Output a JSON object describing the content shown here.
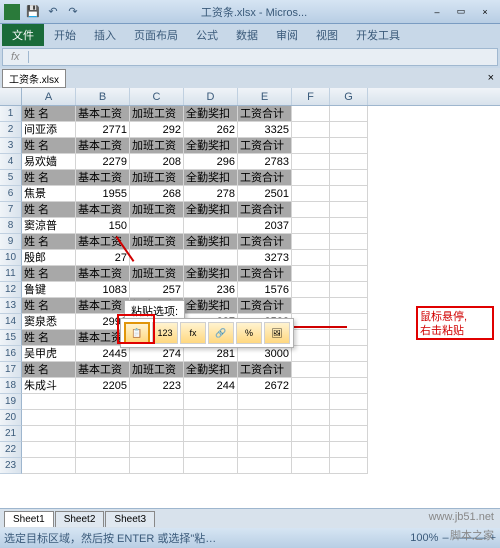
{
  "titlebar": {
    "filename": "工资条.xlsx - Micros...",
    "minimize": "–",
    "restore": "▭",
    "close": "×"
  },
  "qat": {
    "save": "💾",
    "undo": "↶",
    "redo": "↷"
  },
  "ribbon": {
    "file": "文件",
    "tabs": [
      "开始",
      "插入",
      "页面布局",
      "公式",
      "数据",
      "审阅",
      "视图",
      "开发工具"
    ]
  },
  "fx": {
    "label": "fx"
  },
  "workbook": {
    "name": "工资条.xlsx",
    "close": "×"
  },
  "columns": [
    "A",
    "B",
    "C",
    "D",
    "E",
    "F",
    "G"
  ],
  "headers": [
    "姓 名",
    "基本工资",
    "加班工资",
    "全勤奖扣",
    "工资合计"
  ],
  "grid_rows": [
    {
      "n": 1,
      "kind": "h"
    },
    {
      "n": 2,
      "kind": "d",
      "a": "间亚添",
      "b": "2771",
      "c": "292",
      "d": "262",
      "e": "3325"
    },
    {
      "n": 3,
      "kind": "h"
    },
    {
      "n": 4,
      "kind": "d",
      "a": "易欢嫱",
      "b": "2279",
      "c": "208",
      "d": "296",
      "e": "2783"
    },
    {
      "n": 5,
      "kind": "h"
    },
    {
      "n": 6,
      "kind": "d",
      "a": "焦景",
      "b": "1955",
      "c": "268",
      "d": "278",
      "e": "2501"
    },
    {
      "n": 7,
      "kind": "h"
    },
    {
      "n": 8,
      "kind": "d",
      "a": "窦涼普",
      "b": "150",
      "c": "",
      "d": "",
      "e": "2037"
    },
    {
      "n": 9,
      "kind": "h"
    },
    {
      "n": 10,
      "kind": "d",
      "a": "殷郎",
      "b": "27",
      "c": "",
      "d": "",
      "e": "3273"
    },
    {
      "n": 11,
      "kind": "h"
    },
    {
      "n": 12,
      "kind": "d",
      "a": "鲁键",
      "b": "1083",
      "c": "257",
      "d": "236",
      "e": "1576"
    },
    {
      "n": 13,
      "kind": "h"
    },
    {
      "n": 14,
      "kind": "d",
      "a": "窦泉悉",
      "b": "2992",
      "c": "243",
      "d": "287",
      "e": "3522"
    },
    {
      "n": 15,
      "kind": "h"
    },
    {
      "n": 16,
      "kind": "d",
      "a": "吴甲虎",
      "b": "2445",
      "c": "274",
      "d": "281",
      "e": "3000"
    },
    {
      "n": 17,
      "kind": "h"
    },
    {
      "n": 18,
      "kind": "d",
      "a": "朱成斗",
      "b": "2205",
      "c": "223",
      "d": "244",
      "e": "2672"
    },
    {
      "n": 19,
      "kind": "e"
    },
    {
      "n": 20,
      "kind": "e"
    },
    {
      "n": 21,
      "kind": "e"
    },
    {
      "n": 22,
      "kind": "e"
    },
    {
      "n": 23,
      "kind": "e"
    }
  ],
  "paste": {
    "tip_label": "粘贴选项:",
    "opts": [
      "📋",
      "123",
      "fx",
      "🔗",
      "%",
      "🖼"
    ]
  },
  "annotation": {
    "line1": "鼠标悬停,",
    "line2": "右击粘贴"
  },
  "sheets": {
    "s1": "Sheet1",
    "s2": "Sheet2",
    "s3": "Sheet3"
  },
  "status": {
    "text": "选定目标区域，然后按 ENTER 或选择\"粘…",
    "zoom": "100%",
    "minus": "–",
    "plus": "+"
  },
  "watermark": {
    "w1": "www.jb51.net",
    "w2": "脚本之家"
  }
}
